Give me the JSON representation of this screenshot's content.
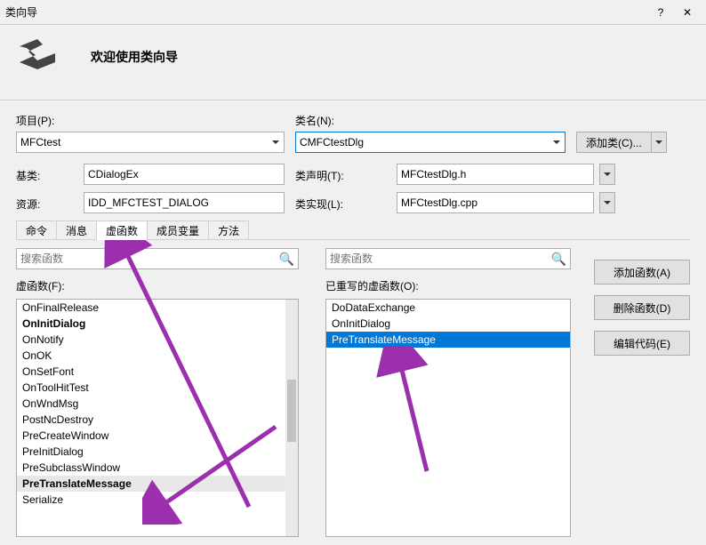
{
  "window": {
    "title": "类向导",
    "help": "?",
    "close": "✕"
  },
  "header": {
    "welcome": "欢迎使用类向导"
  },
  "labels": {
    "project": "项目(P):",
    "className": "类名(N):",
    "base": "基类:",
    "decl": "类声明(T):",
    "resource": "资源:",
    "impl": "类实现(L):",
    "virtFns": "虚函数(F):",
    "overridden": "已重写的虚函数(O):"
  },
  "fields": {
    "project": "MFCtest",
    "className": "CMFCtestDlg",
    "base": "CDialogEx",
    "decl": "MFCtestDlg.h",
    "resource": "IDD_MFCTEST_DIALOG",
    "impl": "MFCtestDlg.cpp"
  },
  "buttons": {
    "addClass": "添加类(C)...",
    "addFn": "添加函数(A)",
    "delFn": "删除函数(D)",
    "editCode": "编辑代码(E)"
  },
  "tabs": [
    "命令",
    "消息",
    "虚函数",
    "成员变量",
    "方法"
  ],
  "activeTab": 2,
  "search": {
    "left_placeholder": "搜索函数",
    "right_placeholder": "搜索函数"
  },
  "leftList": [
    {
      "text": "OnFinalRelease",
      "bold": false
    },
    {
      "text": "OnInitDialog",
      "bold": true
    },
    {
      "text": "OnNotify",
      "bold": false
    },
    {
      "text": "OnOK",
      "bold": false
    },
    {
      "text": "OnSetFont",
      "bold": false
    },
    {
      "text": "OnToolHitTest",
      "bold": false
    },
    {
      "text": "OnWndMsg",
      "bold": false
    },
    {
      "text": "PostNcDestroy",
      "bold": false
    },
    {
      "text": "PreCreateWindow",
      "bold": false
    },
    {
      "text": "PreInitDialog",
      "bold": false
    },
    {
      "text": "PreSubclassWindow",
      "bold": false
    },
    {
      "text": "PreTranslateMessage",
      "bold": true,
      "grey": true
    },
    {
      "text": "Serialize",
      "bold": false
    }
  ],
  "rightList": [
    {
      "text": "DoDataExchange"
    },
    {
      "text": "OnInitDialog"
    },
    {
      "text": "PreTranslateMessage",
      "sel": true
    }
  ]
}
